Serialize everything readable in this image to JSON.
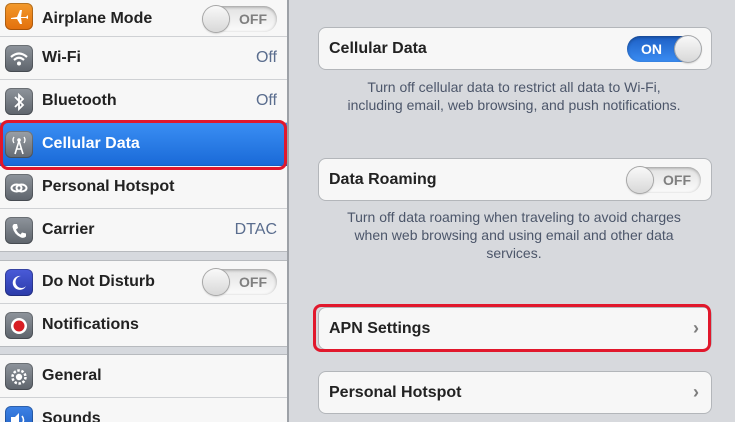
{
  "sidebar": {
    "items": [
      {
        "label": "Airplane Mode",
        "icon": "airplane-icon",
        "toggle": "OFF"
      },
      {
        "label": "Wi-Fi",
        "icon": "wifi-icon",
        "value": "Off"
      },
      {
        "label": "Bluetooth",
        "icon": "bluetooth-icon",
        "value": "Off"
      },
      {
        "label": "Cellular Data",
        "icon": "cellular-antenna-icon",
        "selected": true
      },
      {
        "label": "Personal Hotspot",
        "icon": "hotspot-chain-icon"
      },
      {
        "label": "Carrier",
        "icon": "phone-icon",
        "value": "DTAC"
      },
      {
        "label": "Do Not Disturb",
        "icon": "moon-icon",
        "toggle": "OFF"
      },
      {
        "label": "Notifications",
        "icon": "notifications-icon"
      },
      {
        "label": "General",
        "icon": "gear-icon"
      },
      {
        "label": "Sounds",
        "icon": "speaker-icon"
      }
    ]
  },
  "detail": {
    "cellular_data": {
      "label": "Cellular Data",
      "toggle": "ON"
    },
    "cellular_note": "Turn off cellular data to restrict all data to Wi-Fi, including email, web browsing, and push notifications.",
    "data_roaming": {
      "label": "Data Roaming",
      "toggle": "OFF"
    },
    "roaming_note": "Turn off data roaming when traveling to avoid charges when web browsing and using email and other data services.",
    "apn_settings": {
      "label": "APN Settings"
    },
    "personal_hotspot": {
      "label": "Personal Hotspot"
    }
  },
  "colors": {
    "selection_blue": "#1a6ad8",
    "switch_on_blue": "#2a75dc",
    "highlight_red": "#e1182c"
  }
}
